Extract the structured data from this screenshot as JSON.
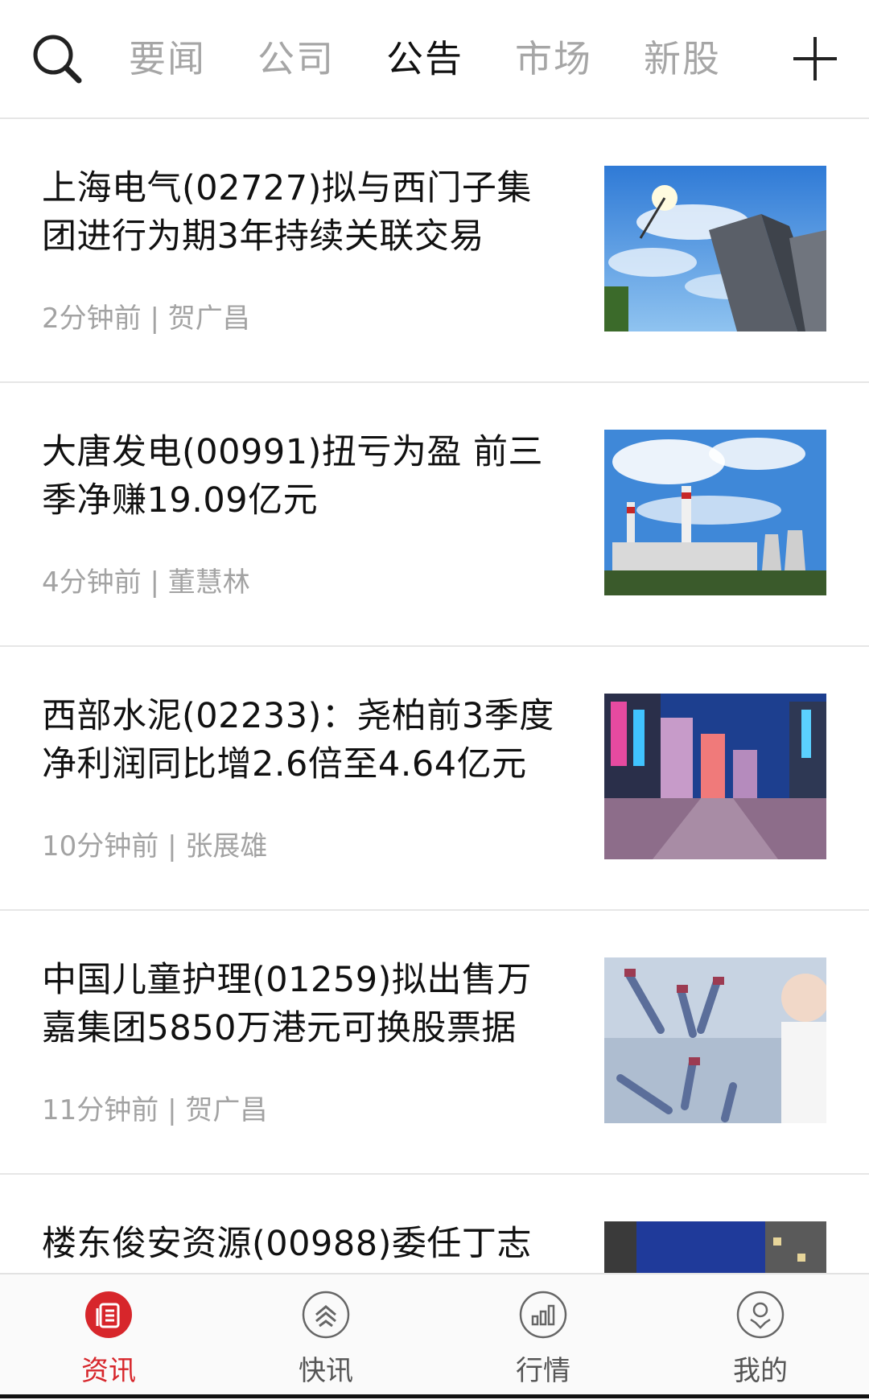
{
  "header": {
    "search_icon": "search-icon",
    "tabs": [
      {
        "label": "要闻",
        "active": false
      },
      {
        "label": "公司",
        "active": false
      },
      {
        "label": "公告",
        "active": true
      },
      {
        "label": "市场",
        "active": false
      },
      {
        "label": "新股",
        "active": false
      }
    ],
    "add_icon": "plus-icon"
  },
  "feed": {
    "items": [
      {
        "title": "上海电气(02727)拟与西门子集团进行为期3年持续关联交易",
        "meta": "2分钟前 | 贺广昌",
        "thumb": "skyscraper-sky"
      },
      {
        "title": "大唐发电(00991)扭亏为盈 前三季净赚19.09亿元",
        "meta": "4分钟前 | 董慧林",
        "thumb": "power-plant"
      },
      {
        "title": "西部水泥(02233)：尧柏前3季度净利润同比增2.6倍至4.64亿元",
        "meta": "10分钟前 | 张展雄",
        "thumb": "city-street-night"
      },
      {
        "title": "中国儿童护理(01259)拟出售万嘉集团5850万港元可换股票据",
        "meta": "11分钟前 | 贺广昌",
        "thumb": "lab-test-tubes"
      },
      {
        "title": "楼东俊安资源(00988)委任丁志",
        "meta": "",
        "thumb": "building-night"
      }
    ]
  },
  "bottom_nav": {
    "items": [
      {
        "label": "资讯",
        "icon": "news-icon",
        "active": true
      },
      {
        "label": "快讯",
        "icon": "flash-news-icon",
        "active": false
      },
      {
        "label": "行情",
        "icon": "market-chart-icon",
        "active": false
      },
      {
        "label": "我的",
        "icon": "profile-icon",
        "active": false
      }
    ]
  },
  "colors": {
    "accent": "#d7262b",
    "tab_inactive": "#a6a6a6",
    "meta_text": "#a3a3a3",
    "divider": "#e6e6e6"
  }
}
